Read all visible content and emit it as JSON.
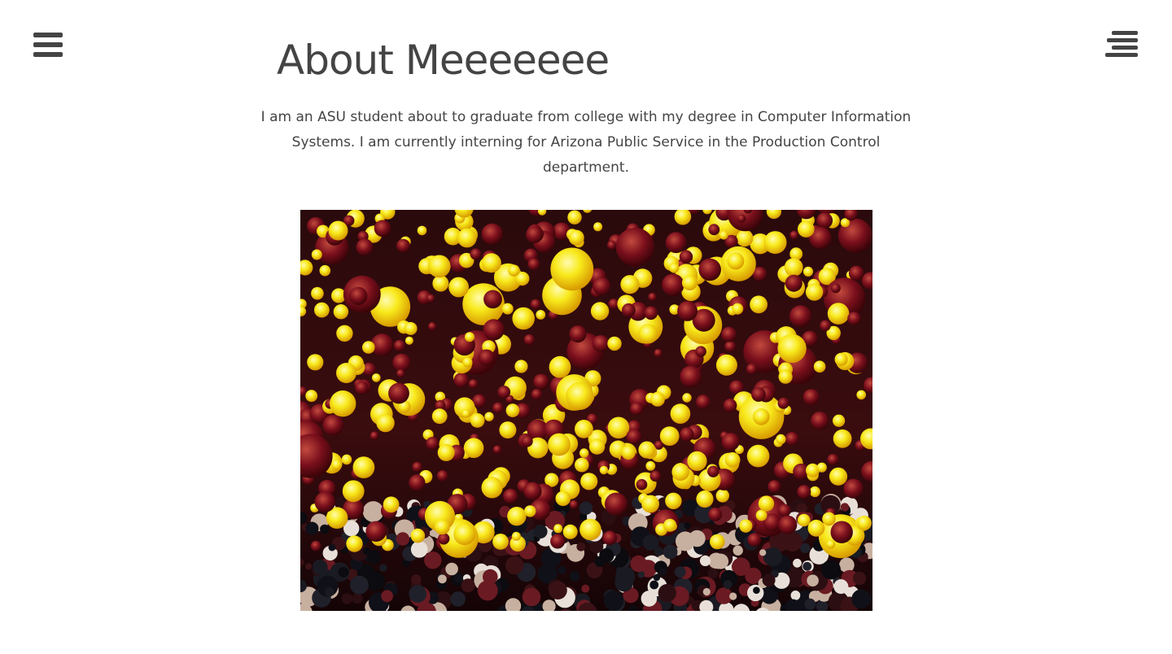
{
  "header": {
    "title": "About Meeeeeee"
  },
  "nav": {
    "left_icon": "hamburger-menu-icon",
    "right_icon": "align-right-menu-icon"
  },
  "content": {
    "intro": "I am an ASU student about to graduate from college with my degree in Computer Information Systems. I am currently interning for Arizona Public Service in the Production Control department."
  },
  "colors": {
    "text": "#444444",
    "icon": "#444444",
    "maroon": "#7a0f1c",
    "gold": "#f8e020"
  }
}
